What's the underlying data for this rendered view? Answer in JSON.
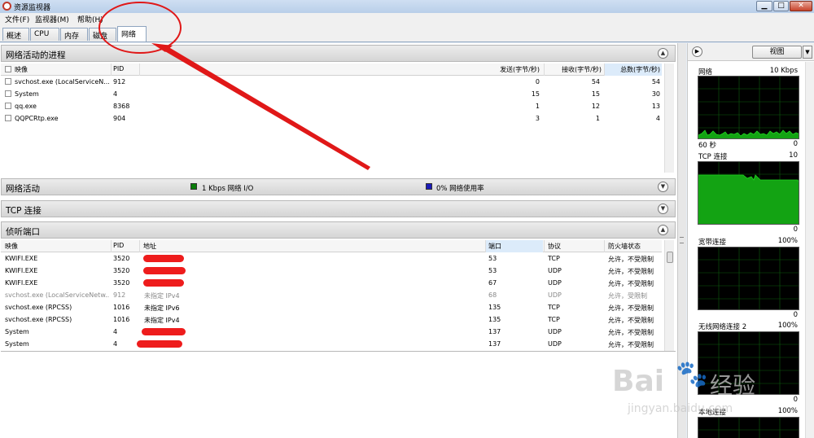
{
  "window": {
    "title": "资源监视器",
    "btn_min": "▁",
    "btn_max": "□",
    "btn_close": "✕"
  },
  "menu": {
    "file": "文件(F)",
    "monitor": "监视器(M)",
    "help": "帮助(H)"
  },
  "tabs": {
    "overview": "概述",
    "cpu": "CPU",
    "memory": "内存",
    "disk": "磁盘",
    "network": "网络"
  },
  "processes": {
    "title": "网络活动的进程",
    "col_image": "映像",
    "col_pid": "PID",
    "col_send": "发送(字节/秒)",
    "col_recv": "接收(字节/秒)",
    "col_total": "总数(字节/秒)",
    "rows": [
      {
        "image": "svchost.exe (LocalServiceN...",
        "pid": "912",
        "send": "0",
        "recv": "54",
        "total": "54"
      },
      {
        "image": "System",
        "pid": "4",
        "send": "15",
        "recv": "15",
        "total": "30"
      },
      {
        "image": "qq.exe",
        "pid": "8368",
        "send": "1",
        "recv": "12",
        "total": "13"
      },
      {
        "image": "QQPCRtp.exe",
        "pid": "904",
        "send": "3",
        "recv": "1",
        "total": "4"
      }
    ]
  },
  "network_activity": {
    "title": "网络活动",
    "io_label": "1 Kbps 网络 I/O",
    "usage_label": "0% 网络使用率",
    "io_color": "#0a7d0a",
    "usage_color": "#1a1ab8"
  },
  "tcp": {
    "title": "TCP 连接"
  },
  "listening": {
    "title": "侦听端口",
    "col_image": "映像",
    "col_pid": "PID",
    "col_addr": "地址",
    "col_port": "端口",
    "col_proto": "协议",
    "col_fw": "防火墙状态",
    "rows": [
      {
        "image": "KWIFI.EXE",
        "pid": "3520",
        "addr": "",
        "port": "53",
        "proto": "TCP",
        "fw": "允许，不受限制",
        "grey": false
      },
      {
        "image": "KWIFI.EXE",
        "pid": "3520",
        "addr": "",
        "port": "53",
        "proto": "UDP",
        "fw": "允许，不受限制",
        "grey": false
      },
      {
        "image": "KWIFI.EXE",
        "pid": "3520",
        "addr": "",
        "port": "67",
        "proto": "UDP",
        "fw": "允许，不受限制",
        "grey": false
      },
      {
        "image": "svchost.exe (LocalServiceNetw...",
        "pid": "912",
        "addr": "未指定 IPv4",
        "port": "68",
        "proto": "UDP",
        "fw": "允许，受限制",
        "grey": true
      },
      {
        "image": "svchost.exe (RPCSS)",
        "pid": "1016",
        "addr": "未指定 IPv6",
        "port": "135",
        "proto": "TCP",
        "fw": "允许，不受限制",
        "grey": false
      },
      {
        "image": "svchost.exe (RPCSS)",
        "pid": "1016",
        "addr": "未指定 IPv4",
        "port": "135",
        "proto": "TCP",
        "fw": "允许，不受限制",
        "grey": false
      },
      {
        "image": "System",
        "pid": "4",
        "addr": "",
        "port": "137",
        "proto": "UDP",
        "fw": "允许，不受限制",
        "grey": false
      },
      {
        "image": "System",
        "pid": "4",
        "addr": "",
        "port": "137",
        "proto": "UDP",
        "fw": "允许，不受限制",
        "grey": false
      }
    ]
  },
  "right_panel": {
    "view_label": "视图",
    "graphs": [
      {
        "name": "网络",
        "max": "10 Kbps",
        "time": "60 秒",
        "min": "0"
      },
      {
        "name": "TCP 连接",
        "max": "10",
        "time": "",
        "min": "0"
      },
      {
        "name": "宽带连接",
        "max": "100%",
        "time": "",
        "min": "0"
      },
      {
        "name": "无线网络连接 2",
        "max": "100%",
        "time": "",
        "min": "0"
      },
      {
        "name": "本地连接",
        "max": "100%",
        "time": "",
        "min": ""
      }
    ],
    "graph_color": "#1fd31f"
  },
  "watermark": {
    "brand": "Bai",
    "brand_suffix": "经验",
    "url": "jingyan.baidu.com"
  }
}
